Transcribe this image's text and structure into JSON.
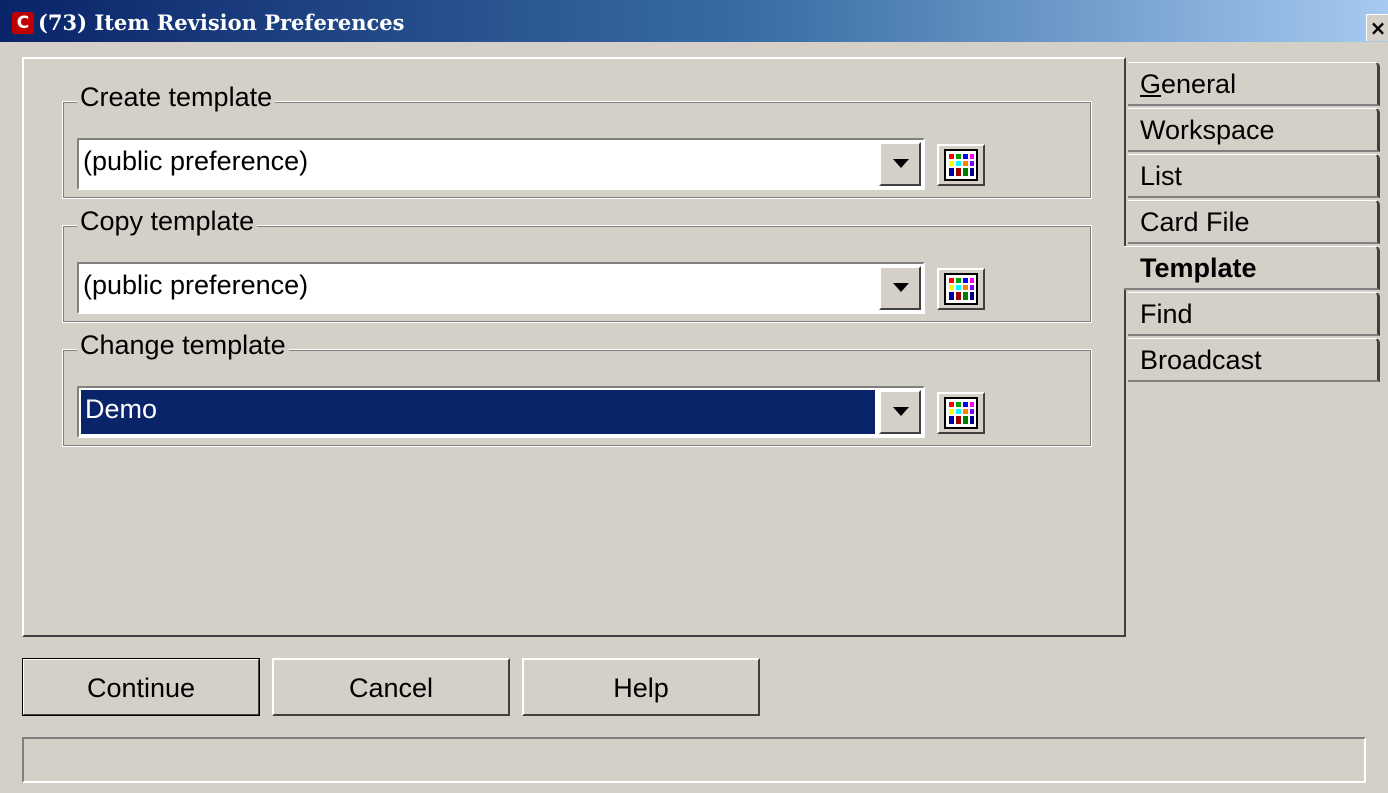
{
  "window": {
    "title": "(73) Item Revision Preferences",
    "icon": "app-logo-icon",
    "close_label": "×"
  },
  "groups": [
    {
      "label": "Create template",
      "value": "(public preference)",
      "selected": false
    },
    {
      "label": "Copy template",
      "value": "(public preference)",
      "selected": false
    },
    {
      "label": "Change template",
      "value": "Demo",
      "selected": true
    }
  ],
  "tabs": [
    {
      "label": "General",
      "mnemonic": "G",
      "rest": "eneral",
      "active": false
    },
    {
      "label": "Workspace",
      "active": false
    },
    {
      "label": "List",
      "active": false
    },
    {
      "label": "Card File",
      "active": false
    },
    {
      "label": "Template",
      "active": true
    },
    {
      "label": "Find",
      "active": false
    },
    {
      "label": "Broadcast",
      "active": false
    }
  ],
  "buttons": {
    "continue_label": "Continue",
    "cancel_label": "Cancel",
    "help_label": "Help"
  },
  "status_text": "",
  "colors": {
    "title_start": "#0a246a",
    "title_end": "#a6caf0",
    "selection": "#0a246a",
    "face": "#d4d0c8"
  }
}
